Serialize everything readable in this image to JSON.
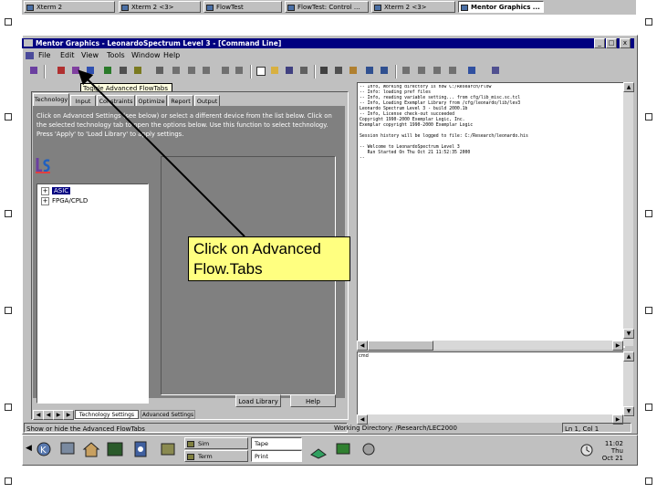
{
  "taskbar_top": {
    "buttons": [
      {
        "label": "Xterm 2"
      },
      {
        "label": "Xterm 2 <3>"
      },
      {
        "label": "FlowTest"
      },
      {
        "label": "FlowTest: Control ..."
      },
      {
        "label": "Xterm 2 <3>"
      },
      {
        "label": "Mentor Graphics ..."
      }
    ]
  },
  "window": {
    "title": "Mentor Graphics - LeonardoSpectrum Level 3 - [Command Line]",
    "controls": {
      "minimize": "_",
      "maximize": "□",
      "close": "x"
    },
    "menu": [
      "File",
      "Edit",
      "View",
      "Tools",
      "Window",
      "Help"
    ]
  },
  "tooltip": "Toggle Advanced FlowTabs",
  "flow_panel": {
    "tabs": [
      "Technology",
      "Input",
      "Constraints",
      "Optimize",
      "Report",
      "Output"
    ],
    "description": "Click on Advanced Settings (see below) or select a different device from the list below. Click on the selected technology tab to open the options below. Use this function to select technology. Press 'Apply' to 'Load Library' to apply settings.",
    "tree": [
      {
        "sign": "+",
        "label": "ASIC",
        "selected": true
      },
      {
        "sign": "+",
        "label": "FPGA/CPLD",
        "selected": false
      }
    ],
    "buttons": {
      "apply": "Load Library",
      "help": "Help"
    },
    "bottom_tabs": [
      "Technology Settings",
      "Advanced Settings"
    ]
  },
  "console": {
    "lines": [
      "-- Info, Working directory is now C:/Research/Flow",
      "-- Info: loading pref files",
      "-- Info, reading variable setting... from cfg/lib_misc.sc.tcl",
      "-- Info, Loading Exemplar Library from /cfg/leonardo/lib/lev3",
      "Leonardo Spectrum Level 3 - build 2000.1b",
      "-- Info, License check-out succeeded",
      "Copyright 1990-2000 Exemplar Logic, Inc.",
      "Exemplar copyright 1990-2000 Exemplar Logic",
      "",
      "Session history will be logged to file: C:/Research/leonardo.his",
      "",
      "-- Welcome to LeonardoSpectrum Level 3",
      "   Run Started On Thu Oct 21 11:52:35 2000",
      "--"
    ]
  },
  "output_pane": {
    "label": "cmd"
  },
  "status": {
    "hint": "Show or hide the Advanced FlowTabs",
    "working_dir": "Working Directory: /Research/LEC2000",
    "position": "Ln 1, Col 1"
  },
  "taskbar_bottom": {
    "buttons": [
      {
        "label": "Sim"
      },
      {
        "label": "Term"
      },
      {
        "label": "Tape"
      },
      {
        "label": "Print"
      }
    ],
    "clock": {
      "time": "11:02",
      "day": "Thu",
      "date": "Oct 21"
    }
  },
  "callout": {
    "line1": "Click on Advanced",
    "line2": "Flow.Tabs"
  },
  "colors": {
    "titlebar": "#000080",
    "face": "#c0c0c0",
    "callout": "#ffff80",
    "tooltip": "#ffffe1"
  }
}
